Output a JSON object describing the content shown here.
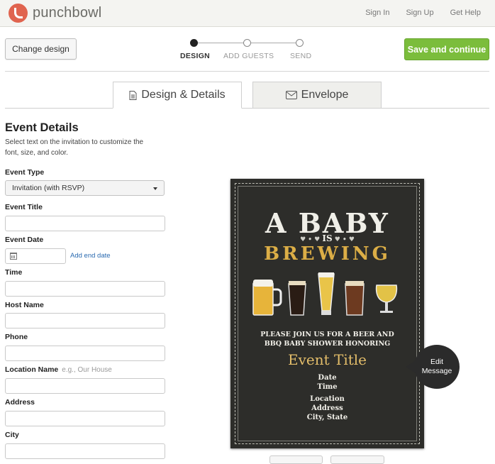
{
  "header": {
    "logo_text": "punchbowl",
    "links": [
      "Sign In",
      "Sign Up",
      "Get Help"
    ]
  },
  "toolbar": {
    "change_design": "Change design",
    "save_continue": "Save and continue",
    "steps": [
      {
        "label": "DESIGN",
        "active": true
      },
      {
        "label": "ADD GUESTS",
        "active": false
      },
      {
        "label": "SEND",
        "active": false
      }
    ]
  },
  "tabs": [
    {
      "label": "Design & Details",
      "icon": "document-icon",
      "selected": true
    },
    {
      "label": "Envelope",
      "icon": "envelope-icon",
      "selected": false
    }
  ],
  "form": {
    "title": "Event Details",
    "subtitle": "Select text on the invitation to customize the font, size, and color.",
    "event_type_label": "Event Type",
    "event_type_value": "Invitation (with RSVP)",
    "event_title_label": "Event Title",
    "event_date_label": "Event Date",
    "add_end_date": "Add end date",
    "time_label": "Time",
    "host_name_label": "Host Name",
    "phone_label": "Phone",
    "location_name_label": "Location Name",
    "location_name_hint": "e.g., Our House",
    "address_label": "Address",
    "city_label": "City"
  },
  "card": {
    "line1": "A BABY",
    "is": "IS",
    "line2": "BREWING",
    "join1": "PLEASE JOIN US FOR A BEER AND",
    "join2": "BBQ BABY SHOWER HONORING",
    "event_title": "Event Title",
    "date": "Date",
    "time": "Time",
    "location": "Location",
    "address": "Address",
    "city_state": "City, State",
    "beer_colors": [
      "#e7b43a",
      "#2a1c14",
      "#e9c449",
      "#6d3a20",
      "#e2c247"
    ]
  },
  "edit_message": {
    "line1": "Edit",
    "line2": "Message"
  },
  "colors": {
    "accent_green": "#7bbd3c",
    "logo_red": "#e0644f",
    "link_blue": "#2a6ab0"
  }
}
